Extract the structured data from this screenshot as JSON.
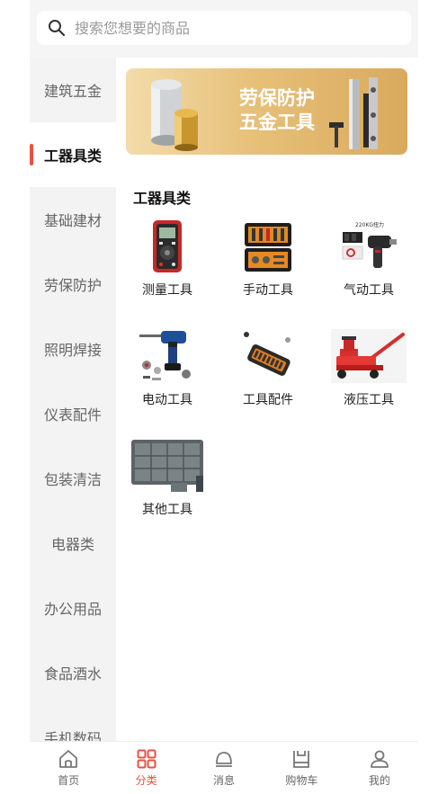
{
  "search": {
    "placeholder": "搜索您想要的商品"
  },
  "sidebar": {
    "items": [
      {
        "label": "建筑五金"
      },
      {
        "label": "工器具类"
      },
      {
        "label": "基础建材"
      },
      {
        "label": "劳保防护"
      },
      {
        "label": "照明焊接"
      },
      {
        "label": "仪表配件"
      },
      {
        "label": "包装清洁"
      },
      {
        "label": "电器类"
      },
      {
        "label": "办公用品"
      },
      {
        "label": "食品酒水"
      },
      {
        "label": "手机数码"
      }
    ]
  },
  "banner": {
    "line1": "劳保防护",
    "line2": "五金工具"
  },
  "section": {
    "title": "工器具类"
  },
  "categories": [
    {
      "label": "测量工具",
      "icon": "multimeter-icon"
    },
    {
      "label": "手动工具",
      "icon": "toolbox-icon"
    },
    {
      "label": "气动工具",
      "icon": "impact-wrench-icon",
      "image_text": "220KG扭力"
    },
    {
      "label": "电动工具",
      "icon": "electric-drill-icon"
    },
    {
      "label": "工具配件",
      "icon": "screwdriver-set-icon"
    },
    {
      "label": "液压工具",
      "icon": "hydraulic-jack-icon"
    },
    {
      "label": "其他工具",
      "icon": "storage-box-icon"
    }
  ],
  "tabbar": {
    "items": [
      {
        "label": "首页",
        "icon": "home-icon"
      },
      {
        "label": "分类",
        "icon": "grid-icon"
      },
      {
        "label": "消息",
        "icon": "bell-icon"
      },
      {
        "label": "购物车",
        "icon": "cart-icon"
      },
      {
        "label": "我的",
        "icon": "user-icon"
      }
    ],
    "active_color": "#e8523f"
  }
}
